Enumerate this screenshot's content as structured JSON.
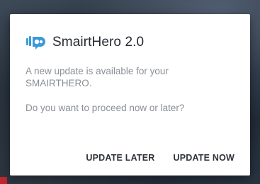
{
  "dialog": {
    "app_title": "SmairtHero 2.0",
    "message": "A new update is available for your SMAIRTHERO.",
    "question": "Do you want to proceed now or later?",
    "buttons": {
      "later": "UPDATE LATER",
      "now": "UPDATE NOW"
    }
  },
  "icons": {
    "app_logo": "smairthero-logo-icon"
  },
  "colors": {
    "logo": "#3a9ad9",
    "title_text": "#262a30",
    "body_text": "#8a8f96",
    "button_text": "#2f3338",
    "dialog_bg": "#ffffff"
  }
}
